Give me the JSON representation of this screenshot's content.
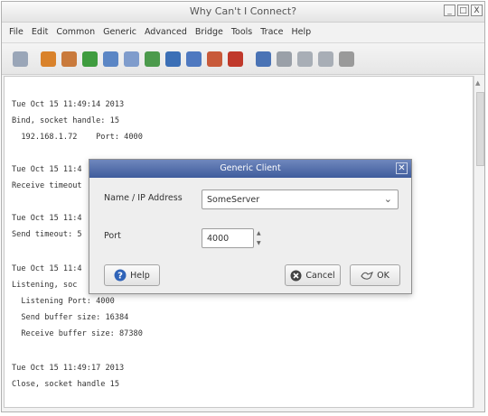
{
  "window": {
    "title": "Why Can't I Connect?",
    "controls": [
      "_",
      "□",
      "X"
    ]
  },
  "menu": [
    "File",
    "Edit",
    "Common",
    "Generic",
    "Advanced",
    "Bridge",
    "Tools",
    "Trace",
    "Help"
  ],
  "toolbar_icons": [
    {
      "name": "document-icon",
      "color": "#9aa6b8"
    },
    {
      "name": "globe-connect-icon",
      "color": "#d9822b"
    },
    {
      "name": "plugin-icon",
      "color": "#c97a3c"
    },
    {
      "name": "green-globe-icon",
      "color": "#3f9c3f"
    },
    {
      "name": "blue-globe-icon",
      "color": "#5b86c5"
    },
    {
      "name": "mail-icon",
      "color": "#7f9ccc"
    },
    {
      "name": "tree-icon",
      "color": "#4c9a4c"
    },
    {
      "name": "arrow-icon",
      "color": "#3b6fb6"
    },
    {
      "name": "puzzle-blue-icon",
      "color": "#4f79c0"
    },
    {
      "name": "puzzle-color-icon",
      "color": "#c85a3a"
    },
    {
      "name": "red-book-icon",
      "color": "#c0392b"
    },
    {
      "name": "blue-stack-icon",
      "color": "#4a73b5"
    },
    {
      "name": "bottle-icon",
      "color": "#9aa0a8"
    },
    {
      "name": "forward-arrow-icon",
      "color": "#a8aeb6"
    },
    {
      "name": "end-arrow-icon",
      "color": "#a8aeb6"
    },
    {
      "name": "gray-box-icon",
      "color": "#9a9a9a"
    }
  ],
  "log": {
    "blocks": [
      {
        "time": "Tue Oct 15 11:49:14 2013",
        "lines": [
          "Bind, socket handle: 15",
          "  192.168.1.72    Port: 4000"
        ]
      },
      {
        "time": "Tue Oct 15 11:4",
        "lines": [
          "Receive timeout"
        ]
      },
      {
        "time": "Tue Oct 15 11:4",
        "lines": [
          "Send timeout: 5"
        ]
      },
      {
        "time": "Tue Oct 15 11:4",
        "lines": [
          "Listening, soc",
          "  Listening Port: 4000",
          "  Send buffer size: 16384",
          "  Receive buffer size: 87380"
        ]
      },
      {
        "time": "Tue Oct 15 11:49:17 2013",
        "lines": [
          "Close, socket handle 15"
        ]
      }
    ]
  },
  "dialog": {
    "title": "Generic Client",
    "name_label": "Name / IP Address",
    "name_value": "SomeServer",
    "port_label": "Port",
    "port_value": "4000",
    "help_label": "Help",
    "cancel_label": "Cancel",
    "ok_label": "OK"
  }
}
